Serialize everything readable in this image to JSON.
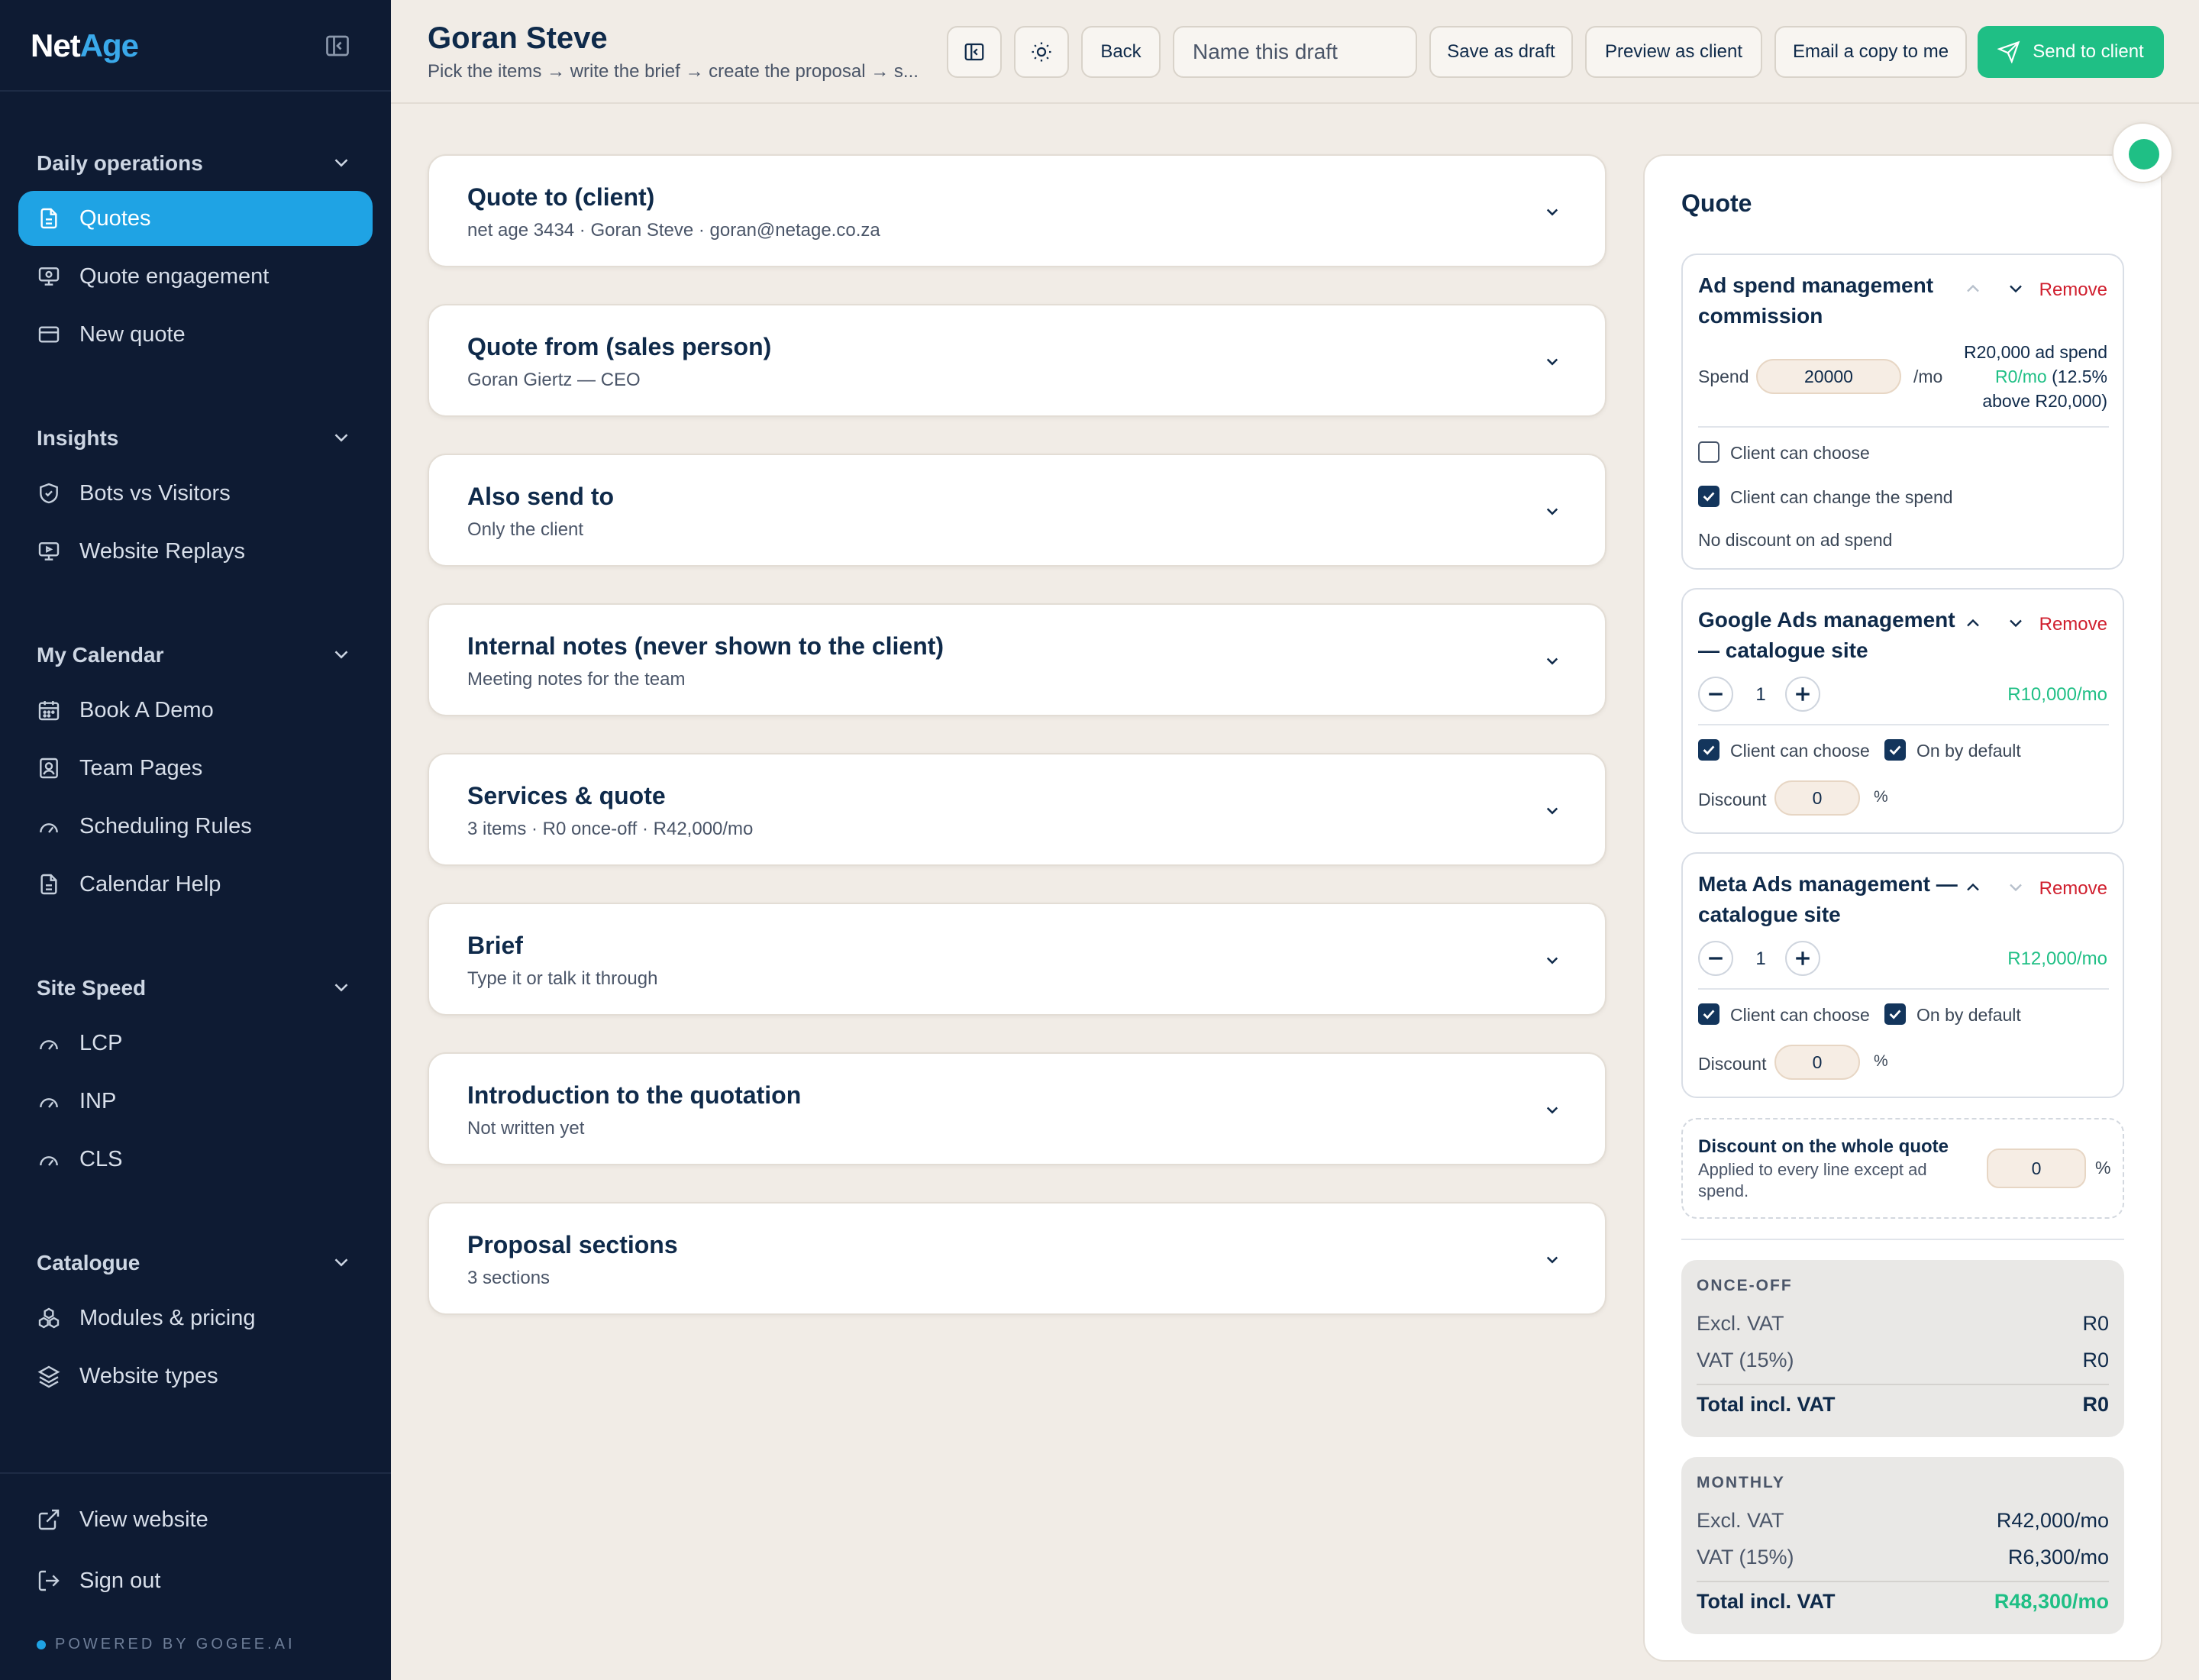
{
  "sidebar": {
    "logo_a": "Net",
    "logo_b": "Age",
    "groups": [
      {
        "title": "Daily operations",
        "items": [
          {
            "label": "Quotes",
            "icon": "document-icon",
            "active": true
          },
          {
            "label": "Quote engagement",
            "icon": "presentation-icon"
          },
          {
            "label": "New quote",
            "icon": "card-icon"
          }
        ]
      },
      {
        "title": "Insights",
        "items": [
          {
            "label": "Bots vs Visitors",
            "icon": "shield-icon"
          },
          {
            "label": "Website Replays",
            "icon": "screen-play-icon"
          }
        ]
      },
      {
        "title": "My Calendar",
        "items": [
          {
            "label": "Book A Demo",
            "icon": "calendar-icon"
          },
          {
            "label": "Team Pages",
            "icon": "user-badge-icon"
          },
          {
            "label": "Scheduling Rules",
            "icon": "gauge-icon"
          },
          {
            "label": "Calendar Help",
            "icon": "document-icon"
          }
        ]
      },
      {
        "title": "Site Speed",
        "items": [
          {
            "label": "LCP",
            "icon": "gauge-icon"
          },
          {
            "label": "INP",
            "icon": "gauge-icon"
          },
          {
            "label": "CLS",
            "icon": "gauge-icon"
          }
        ]
      },
      {
        "title": "Catalogue",
        "items": [
          {
            "label": "Modules & pricing",
            "icon": "modules-icon"
          },
          {
            "label": "Website types",
            "icon": "layers-icon"
          }
        ]
      }
    ],
    "footer": [
      {
        "label": "View website",
        "icon": "external-link-icon"
      },
      {
        "label": "Sign out",
        "icon": "sign-out-icon"
      }
    ],
    "powered": "POWERED BY GOGEE.AI"
  },
  "header": {
    "title": "Goran Steve",
    "subtitle": "Pick the items → write the brief → create the proposal → s...",
    "back": "Back",
    "draft_placeholder": "Name this draft",
    "save_draft": "Save as draft",
    "preview": "Preview as client",
    "email_copy": "Email a copy to me",
    "send": "Send to client"
  },
  "cards": [
    {
      "title": "Quote to (client)",
      "sub": "net age 3434 · Goran Steve · goran@netage.co.za"
    },
    {
      "title": "Quote from (sales person)",
      "sub": "Goran Giertz — CEO"
    },
    {
      "title": "Also send to",
      "sub": "Only the client"
    },
    {
      "title": "Internal notes (never shown to the client)",
      "sub": "Meeting notes for the team"
    },
    {
      "title": "Services & quote",
      "sub": "3 items · R0 once-off · R42,000/mo"
    },
    {
      "title": "Brief",
      "sub": "Type it or talk it through"
    },
    {
      "title": "Introduction to the quotation",
      "sub": "Not written yet"
    },
    {
      "title": "Proposal sections",
      "sub": "3 sections"
    }
  ],
  "quote": {
    "title": "Quote",
    "remove": "Remove",
    "ad_spend": {
      "title": "Ad spend management commission",
      "spend_label": "Spend",
      "spend_value": "20000",
      "per_mo": "/mo",
      "summary_1": "R20,000 ad spend",
      "summary_2a": "R0/mo",
      "summary_2b": " (12.5%",
      "summary_3": "above R20,000)",
      "client_choose": "Client can choose",
      "client_choose_checked": false,
      "client_change": "Client can change the spend",
      "client_change_checked": true,
      "no_discount": "No discount on ad spend"
    },
    "google": {
      "title": "Google Ads management — catalogue site",
      "qty": "1",
      "price": "R10,000/mo",
      "client_choose": "Client can choose",
      "on_default": "On by default",
      "discount_label": "Discount",
      "discount_value": "0",
      "pct": "%"
    },
    "meta": {
      "title": "Meta Ads management — catalogue site",
      "qty": "1",
      "price": "R12,000/mo",
      "client_choose": "Client can choose",
      "on_default": "On by default",
      "discount_label": "Discount",
      "discount_value": "0",
      "pct": "%"
    },
    "whole": {
      "title": "Discount on the whole quote",
      "sub": "Applied to every line except ad spend.",
      "value": "0",
      "pct": "%"
    },
    "once_off": {
      "heading": "ONCE-OFF",
      "excl_label": "Excl. VAT",
      "excl": "R0",
      "vat_label": "VAT (15%)",
      "vat": "R0",
      "total_label": "Total incl. VAT",
      "total": "R0"
    },
    "monthly": {
      "heading": "MONTHLY",
      "excl_label": "Excl. VAT",
      "excl": "R42,000/mo",
      "vat_label": "VAT (15%)",
      "vat": "R6,300/mo",
      "total_label": "Total incl. VAT",
      "total": "R48,300/mo"
    }
  },
  "colors": {
    "accent": "#1fa3e4",
    "success": "#1fbf85",
    "danger": "#d01f2e",
    "sidebar": "#0e1b33"
  }
}
